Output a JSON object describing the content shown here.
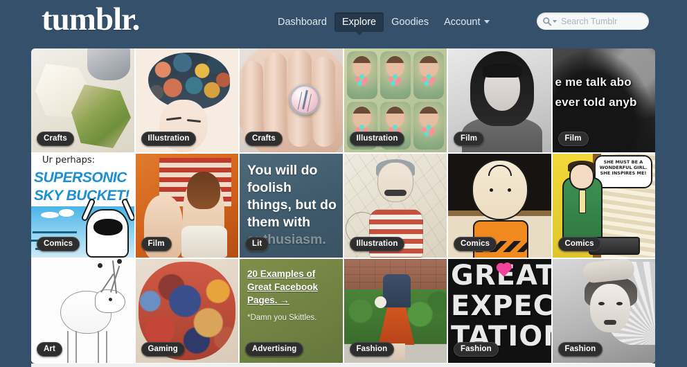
{
  "site": {
    "logo": "tumblr.",
    "background_color": "#35506b"
  },
  "nav": {
    "items": [
      {
        "label": "Dashboard",
        "active": false
      },
      {
        "label": "Explore",
        "active": true
      },
      {
        "label": "Goodies",
        "active": false
      },
      {
        "label": "Account",
        "active": false,
        "has_dropdown": true
      }
    ]
  },
  "search": {
    "placeholder": "Search Tumblr",
    "value": "",
    "icon": "search-icon"
  },
  "grid": {
    "rows": 3,
    "columns": 6,
    "tiles": [
      {
        "tag": "Crafts",
        "kind": "image",
        "art": "art-crafts-globe"
      },
      {
        "tag": "Illustration",
        "kind": "image",
        "art": "art-illus-hair"
      },
      {
        "tag": "Crafts",
        "kind": "image",
        "art": "art-ring"
      },
      {
        "tag": "Illustration",
        "kind": "image",
        "art": "art-portraits"
      },
      {
        "tag": "Film",
        "kind": "image",
        "art": "art-bw-portrait"
      },
      {
        "tag": "Film",
        "kind": "image",
        "art": "art-film-sub",
        "subtitle_line1": "e me talk abo",
        "subtitle_line2": "ever told anyb"
      },
      {
        "tag": "Comics",
        "kind": "image",
        "art": "art-comic-sky",
        "caption_top": "Ur perhaps:",
        "caption_main_line1": "SUPERSONIC",
        "caption_main_line2": "SKY BUCKET!"
      },
      {
        "tag": "Film",
        "kind": "image",
        "art": "art-film-flag"
      },
      {
        "tag": "Lit",
        "kind": "quote",
        "art": "quote-tile",
        "quote_visible": "You will do foolish things, but do them with ",
        "quote_faded": "enthusiasm."
      },
      {
        "tag": "Illustration",
        "kind": "image",
        "art": "art-illus-sailor"
      },
      {
        "tag": "Comics",
        "kind": "image",
        "art": "art-comic-cb"
      },
      {
        "tag": "Comics",
        "kind": "image",
        "art": "art-comic-news",
        "speech_bubble": "SHE MUST BE A WONDERFUL GIRL. SHE INSPIRES ME!"
      },
      {
        "tag": "Art",
        "kind": "image",
        "art": "art-art-deer"
      },
      {
        "tag": "Gaming",
        "kind": "image",
        "art": "art-gaming"
      },
      {
        "tag": "Advertising",
        "kind": "link",
        "art": "ad-tile",
        "link_text": "20 Examples of Great Facebook Pages. →",
        "sub_text": "*Damn you Skittles."
      },
      {
        "tag": "Fashion",
        "kind": "image",
        "art": "art-fashion-street"
      },
      {
        "tag": "Fashion",
        "kind": "image",
        "art": "art-fashion-great",
        "poster_line1": "GREAT",
        "poster_line2": "EXPECT",
        "poster_line3": "TATIONS"
      },
      {
        "tag": "Fashion",
        "kind": "image",
        "art": "art-fashion-bw"
      }
    ]
  }
}
